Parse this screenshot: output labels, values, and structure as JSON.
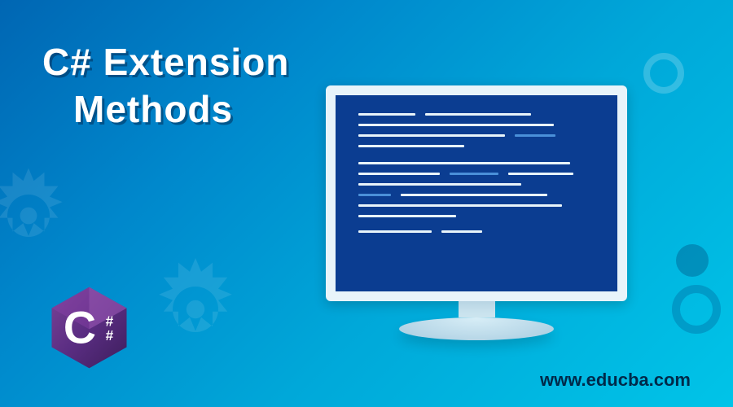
{
  "title_line1": "C# Extension",
  "title_line2": "Methods",
  "website_url": "www.educba.com",
  "logo_text": "C",
  "logo_hash": "#"
}
